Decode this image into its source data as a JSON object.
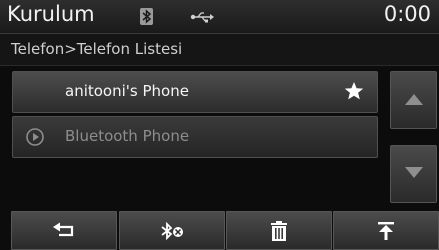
{
  "header": {
    "title": "Kurulum",
    "clock": "0:00",
    "status_icons": [
      "bluetooth-icon",
      "usb-icon"
    ]
  },
  "breadcrumb": "Telefon>Telefon Listesi",
  "phone_list": [
    {
      "name": "anitooni's Phone",
      "icon": "star-icon",
      "favorite": true
    },
    {
      "name": "Bluetooth Phone",
      "icon": "play-icon",
      "favorite": false
    }
  ],
  "scroll": {
    "up_icon": "triangle-up-icon",
    "down_icon": "triangle-down-icon"
  },
  "bottom_bar": {
    "buttons": [
      "back-icon",
      "bluetooth-disconnect-icon",
      "trash-icon",
      "move-to-top-icon"
    ]
  },
  "colors": {
    "background": "#0c0c0c",
    "button": "#3a3a3a",
    "text_active": "#f5f5f5",
    "text_inactive": "#8d8d8d"
  }
}
